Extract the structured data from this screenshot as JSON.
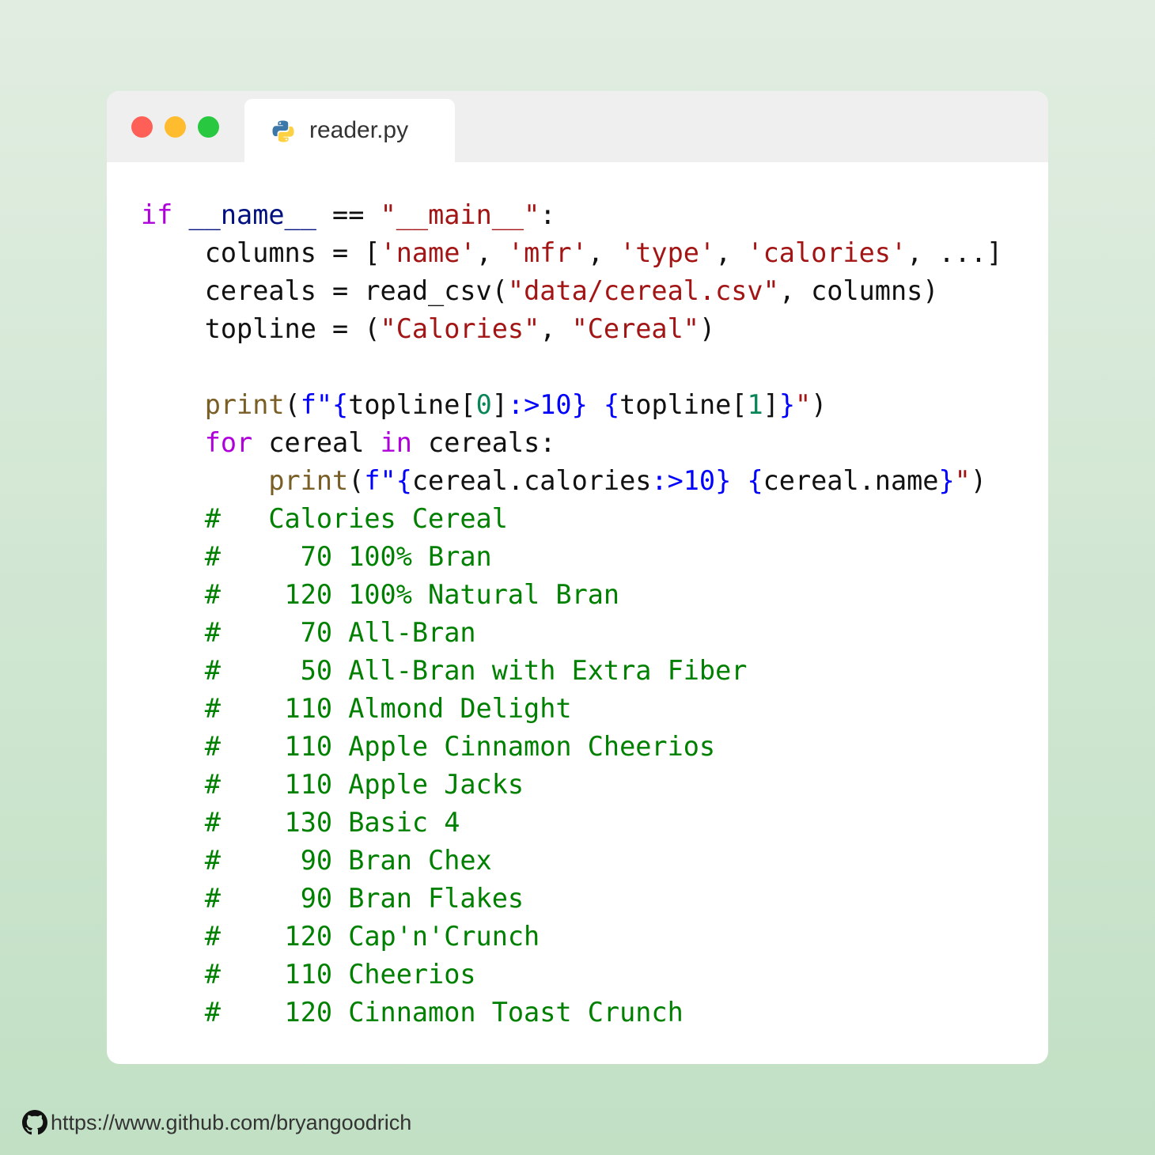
{
  "window": {
    "file_name": "reader.py",
    "file_icon": "python-logo-icon"
  },
  "code": {
    "l1": {
      "kw_if": "if",
      "sp1": " ",
      "dunder": "__name__",
      "op": " == ",
      "str": "\"__main__\"",
      "colon": ":"
    },
    "l2": {
      "indent": "    ",
      "pre": "columns = [",
      "s1": "'name'",
      "c1": ", ",
      "s2": "'mfr'",
      "c2": ", ",
      "s3": "'type'",
      "c3": ", ",
      "s4": "'calories'",
      "post": ", ...]"
    },
    "l3": {
      "indent": "    ",
      "pre": "cereals = read_csv(",
      "str": "\"data/cereal.csv\"",
      "post": ", columns)"
    },
    "l4": {
      "indent": "    ",
      "pre": "topline = (",
      "s1": "\"Calories\"",
      "mid": ", ",
      "s2": "\"Cereal\"",
      "post": ")"
    },
    "l6": {
      "indent": "    ",
      "fn": "print",
      "open": "(",
      "fpre": "f\"",
      "b1": "{",
      "expr1": "topline[",
      "idx1": "0",
      "close1": "]",
      "spec1": ":>10",
      "b2": "}",
      "sp": " ",
      "b3": "{",
      "expr2": "topline[",
      "idx2": "1",
      "close2": "]",
      "b4": "}",
      "fpost": "\"",
      "end": ")"
    },
    "l7": {
      "indent": "    ",
      "kw_for": "for",
      "v1": " cereal ",
      "kw_in": "in",
      "v2": " cereals:"
    },
    "l8": {
      "indent": "        ",
      "fn": "print",
      "open": "(",
      "fpre": "f\"",
      "b1": "{",
      "expr1": "cereal.calories",
      "spec1": ":>10",
      "b2": "}",
      "sp": " ",
      "b3": "{",
      "expr2": "cereal.name",
      "b4": "}",
      "fpost": "\"",
      "end": ")"
    },
    "output_indent": "    ",
    "output_comments": [
      "#   Calories Cereal",
      "#     70 100% Bran",
      "#    120 100% Natural Bran",
      "#     70 All-Bran",
      "#     50 All-Bran with Extra Fiber",
      "#    110 Almond Delight",
      "#    110 Apple Cinnamon Cheerios",
      "#    110 Apple Jacks",
      "#    130 Basic 4",
      "#     90 Bran Chex",
      "#     90 Bran Flakes",
      "#    120 Cap'n'Crunch",
      "#    110 Cheerios",
      "#    120 Cinnamon Toast Crunch"
    ]
  },
  "footer": {
    "icon": "github-icon",
    "url_text": "https://www.github.com/bryangoodrich"
  },
  "colors": {
    "keyword": "#af00db",
    "string": "#a31515",
    "function": "#795e26",
    "number": "#098658",
    "comment": "#008000",
    "brace": "#0000ff",
    "dunder": "#001080"
  }
}
